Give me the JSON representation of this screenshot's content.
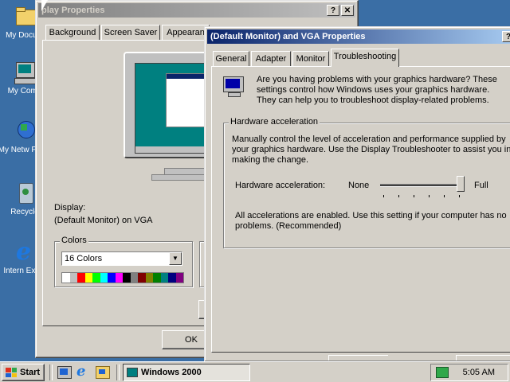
{
  "desktop": {
    "icons": [
      {
        "label": "My Docum",
        "icon": "folder-icon"
      },
      {
        "label": "My Comp",
        "icon": "computer-icon"
      },
      {
        "label": "My Netw Place",
        "icon": "network-icon"
      },
      {
        "label": "Recycle",
        "icon": "recycle-bin-icon"
      },
      {
        "label": "Intern Explo",
        "icon": "ie-icon"
      }
    ]
  },
  "display_props": {
    "title": "play Properties",
    "tabs": [
      "Background",
      "Screen Saver",
      "Appearan"
    ],
    "display_label": "Display:",
    "display_value": "(Default Monitor) on VGA",
    "colors_group": "Colors",
    "colors_value": "16 Colors",
    "ok_label": "OK",
    "palette": [
      "#ffffff",
      "#c0c0c0",
      "#ff0000",
      "#ffff00",
      "#00ff00",
      "#00ffff",
      "#0000ff",
      "#ff00ff",
      "#000000",
      "#808080",
      "#800000",
      "#808000",
      "#008000",
      "#008080",
      "#000080",
      "#800080"
    ]
  },
  "vga_props": {
    "title": "(Default Monitor) and VGA Properties",
    "tabs": [
      "General",
      "Adapter",
      "Monitor",
      "Troubleshooting"
    ],
    "active_tab": "Troubleshooting",
    "intro": "Are you having problems with your graphics hardware? These settings control how Windows uses your graphics hardware. They can help you to troubleshoot display-related problems.",
    "hw_group": "Hardware acceleration",
    "hw_desc": "Manually control the level of acceleration and performance supplied by your graphics hardware. Use the Display Troubleshooter to assist you in making the change.",
    "slider_label": "Hardware acceleration:",
    "slider_min": "None",
    "slider_max": "Full",
    "slider_level": 1.0,
    "status": "All accelerations are enabled. Use this setting if your computer has no problems. (Recommended)"
  },
  "taskbar": {
    "start_label": "Start",
    "task_label": "Windows 2000",
    "clock": "5:05 AM"
  }
}
